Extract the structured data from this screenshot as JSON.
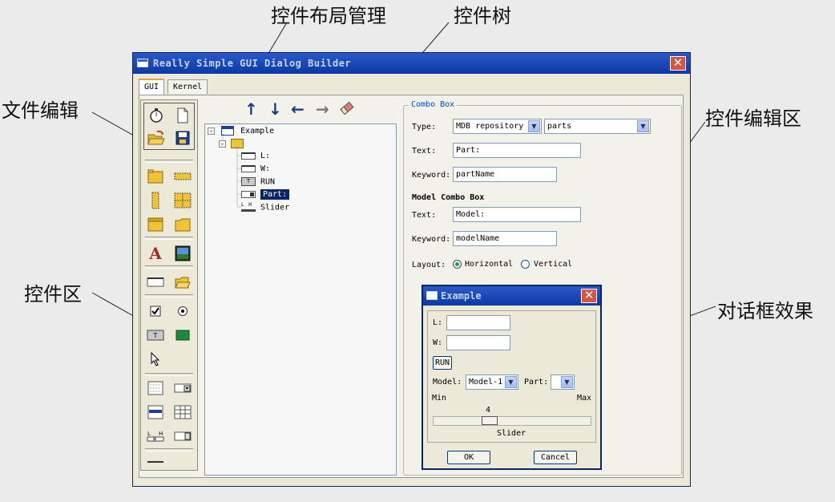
{
  "annotations": {
    "layout_mgmt": "控件布局管理",
    "control_tree": "控件树",
    "file_edit": "文件编辑",
    "control_area": "控件区",
    "control_edit_area": "控件编辑区",
    "dialog_effect": "对话框效果"
  },
  "window": {
    "title": "Really Simple GUI Dialog Builder",
    "tabs": [
      "GUI",
      "Kernel"
    ],
    "active_tab": "GUI"
  },
  "toolbar": {
    "file_icons": [
      "stopwatch-icon",
      "new-file-icon",
      "open-folder-icon",
      "save-disk-icon"
    ],
    "layout_icons": [
      "up-arrow-icon",
      "down-arrow-icon",
      "left-arrow-icon",
      "right-arrow-icon",
      "eraser-icon"
    ],
    "arrows": [
      "↑",
      "↓",
      "←",
      "→"
    ]
  },
  "tree": {
    "root": "Example",
    "items": [
      "L:",
      "W:",
      "RUN",
      "Part:",
      "Slider"
    ],
    "selected": "Part:",
    "run_badge": "T",
    "slider_badge": "L H"
  },
  "editor": {
    "group_title": "Combo Box",
    "type_label": "Type:",
    "type_value": "MDB repository",
    "type_value2": "parts",
    "text_label": "Text:",
    "text_value": "Part:",
    "keyword_label": "Keyword:",
    "keyword_value": "partName",
    "model_section": "Model Combo Box",
    "model_text_label": "Text:",
    "model_text_value": "Model:",
    "model_keyword_label": "Keyword:",
    "model_keyword_value": "modelName",
    "layout_label": "Layout:",
    "layout_options": [
      "Horizontal",
      "Vertical"
    ],
    "layout_selected": "Horizontal"
  },
  "preview": {
    "title": "Example",
    "l_label": "L:",
    "w_label": "W:",
    "run_label": "RUN",
    "model_label": "Model:",
    "model_value": "Model-1",
    "part_label": "Part:",
    "min_label": "Min",
    "max_label": "Max",
    "slider_value": "4",
    "slider_fraction": 0.34,
    "slider_label": "Slider",
    "ok_label": "OK",
    "cancel_label": "Cancel"
  },
  "colors": {
    "titlebar": "#0a3aa6",
    "selection": "#0a246a",
    "close": "#d9543d",
    "accent_text": "#0046d5"
  }
}
